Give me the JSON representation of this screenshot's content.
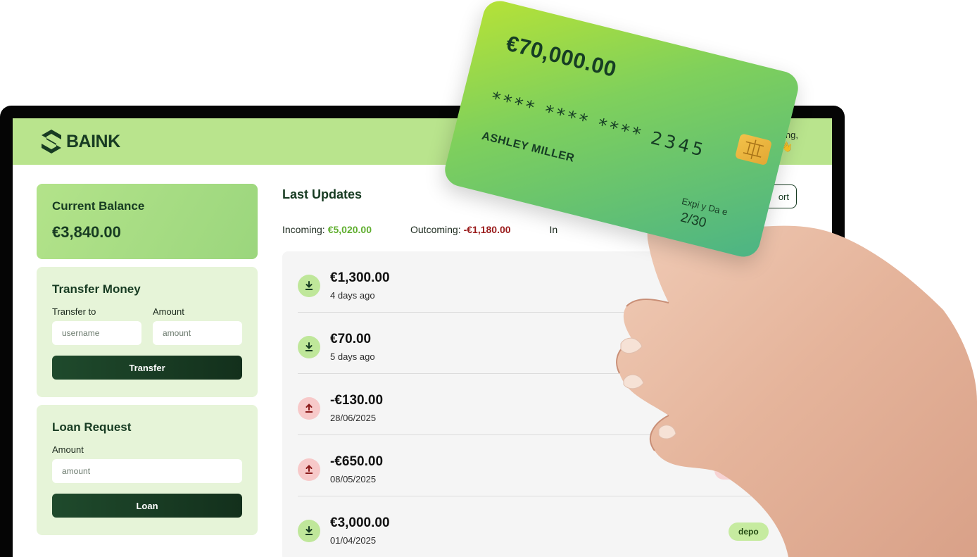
{
  "brand": {
    "name": "BAINK"
  },
  "header": {
    "greeting": "ng,",
    "emoji": "👋"
  },
  "balance": {
    "title": "Current Balance",
    "value": "€3,840.00"
  },
  "transfer": {
    "title": "Transfer Money",
    "to_label": "Transfer to",
    "to_placeholder": "username",
    "amount_label": "Amount",
    "amount_placeholder": "amount",
    "button": "Transfer"
  },
  "loan": {
    "title": "Loan Request",
    "amount_label": "Amount",
    "amount_placeholder": "amount",
    "button": "Loan"
  },
  "updates": {
    "title": "Last Updates",
    "sort_label": "ort",
    "incoming_label": "Incoming:",
    "incoming_value": "€5,020.00",
    "outcoming_label": "Outcoming:",
    "outcoming_value": "-€1,180.00",
    "interest_label": "In"
  },
  "movements": [
    {
      "type": "in",
      "amount": "€1,300.00",
      "date": "4 days ago",
      "badge": ""
    },
    {
      "type": "in",
      "amount": "€70.00",
      "date": "5 days ago",
      "badge": ""
    },
    {
      "type": "out",
      "amount": "-€130.00",
      "date": "28/06/2025",
      "badge": ""
    },
    {
      "type": "out",
      "amount": "-€650.00",
      "date": "08/05/2025",
      "badge": "wit"
    },
    {
      "type": "in",
      "amount": "€3,000.00",
      "date": "01/04/2025",
      "badge": "depo"
    }
  ],
  "credit_card": {
    "balance": "€70,000.00",
    "number": "**** **** **** 2345",
    "holder": "ASHLEY MILLER",
    "expiry_label": "Expi y Da e",
    "expiry": "2/30"
  },
  "colors": {
    "header_bg": "#b9e48d",
    "brand_dark": "#173b22",
    "incoming": "#5fae2e",
    "outgoing": "#9a1b1b"
  },
  "icons": {
    "logo": "baink-logo-icon",
    "deposit": "download-arrow-icon",
    "withdrawal": "upload-arrow-icon",
    "card_chip": "chip-icon"
  }
}
